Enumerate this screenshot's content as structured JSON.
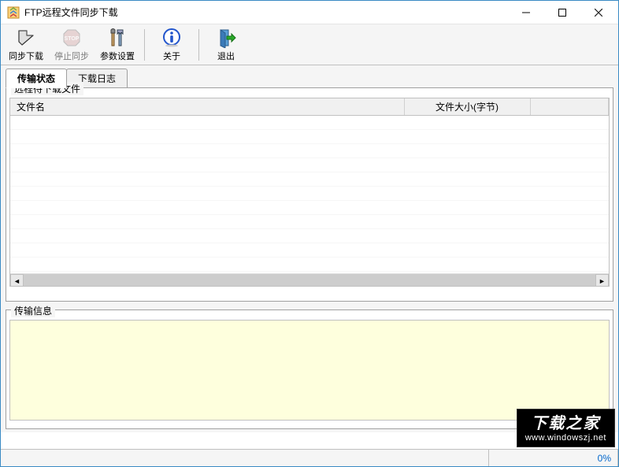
{
  "window": {
    "title": "FTP远程文件同步下载"
  },
  "toolbar": {
    "sync_download": "同步下载",
    "stop_sync": "停止同步",
    "settings": "参数设置",
    "about": "关于",
    "exit": "退出"
  },
  "tabs": {
    "transfer_status": "传输状态",
    "download_log": "下载日志"
  },
  "groups": {
    "remote_pending": "远程待下载文件",
    "transfer_info": "传输信息"
  },
  "table": {
    "col_filename": "文件名",
    "col_filesize": "文件大小(字节)",
    "rows": []
  },
  "status": {
    "progress_label": "0%",
    "progress_value": 0
  },
  "watermark": {
    "main": "下载之家",
    "sub": "www.windowszj.net"
  }
}
